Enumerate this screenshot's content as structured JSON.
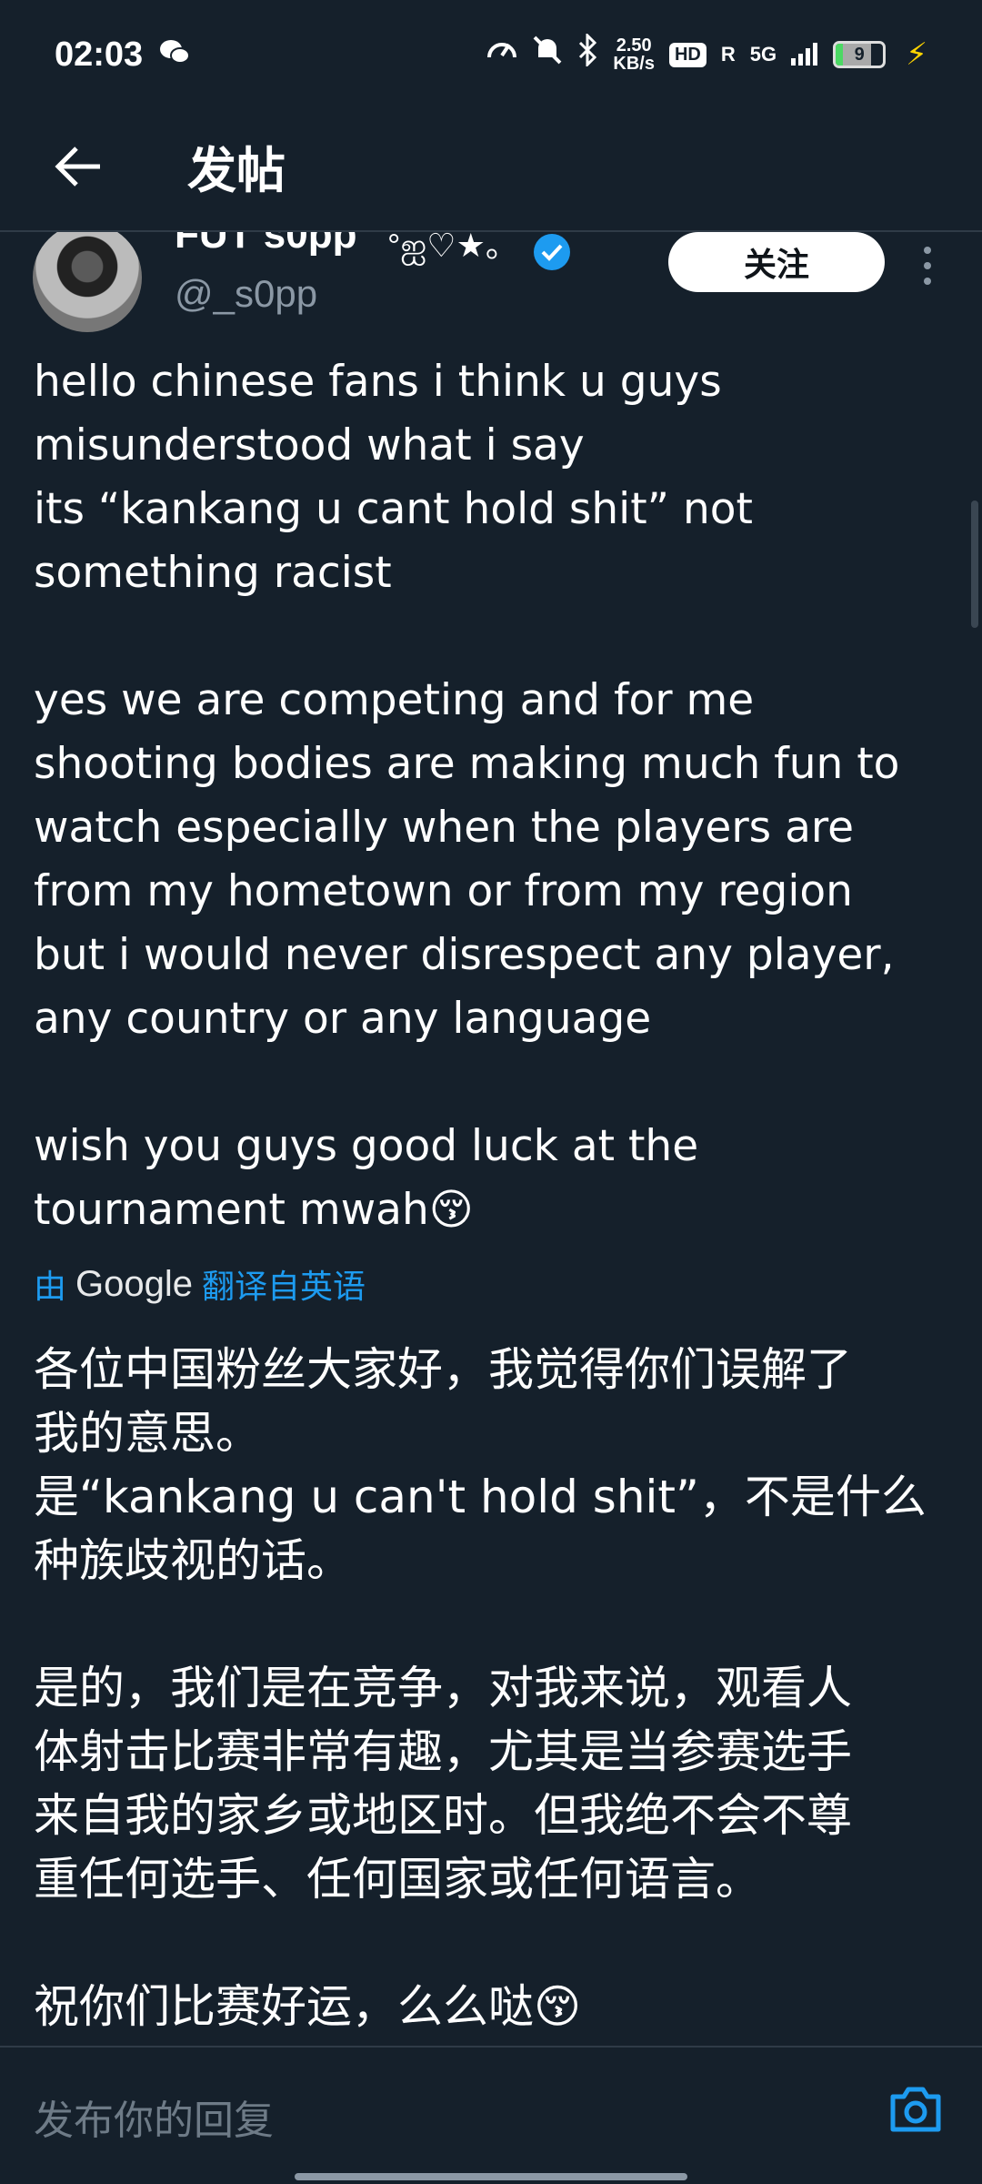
{
  "status_bar": {
    "time": "02:03",
    "net_speed_value": "2.50",
    "net_speed_unit": "KB/s",
    "hd_label": "HD",
    "signal_label": "R",
    "network_label": "5G",
    "battery_level": "9",
    "battery_fraction": 0.09
  },
  "header": {
    "title": "发帖"
  },
  "author": {
    "display_name": "FUT s0pp",
    "name_decoration": "°ஐ♡★。",
    "handle": "@_s0pp",
    "follow_label": "关注"
  },
  "tweet": {
    "paragraphs": [
      "hello chinese fans i think u guys\nmisunderstood what i say\nits “kankang u cant hold shit” not\nsomething racist",
      "yes we are competing and for me\nshooting bodies are making much fun to\nwatch especially when the players are\nfrom my hometown or from my region\nbut i would never disrespect any player,\nany country or any language",
      "wish you guys good luck at the\ntournament mwah😚"
    ]
  },
  "translation": {
    "by_label": "由",
    "provider": "Google",
    "source_label": "翻译自英语",
    "paragraphs": [
      "各位中国粉丝大家好，我觉得你们误解了\n我的意思。\n是“kankang u can't hold shit”，不是什么\n种族歧视的话。",
      "是的，我们是在竞争，对我来说，观看人\n体射击比赛非常有趣，尤其是当参赛选手\n来自我的家乡或地区时。但我绝不会不尊\n重任何选手、任何国家或任何语言。",
      "祝你们比赛好运，么么哒😚"
    ]
  },
  "reply": {
    "placeholder": "发布你的回复"
  },
  "colors": {
    "background": "#15202b",
    "accent": "#1d9bf0",
    "text": "#ffffff",
    "secondary_text": "#8b98a5"
  }
}
